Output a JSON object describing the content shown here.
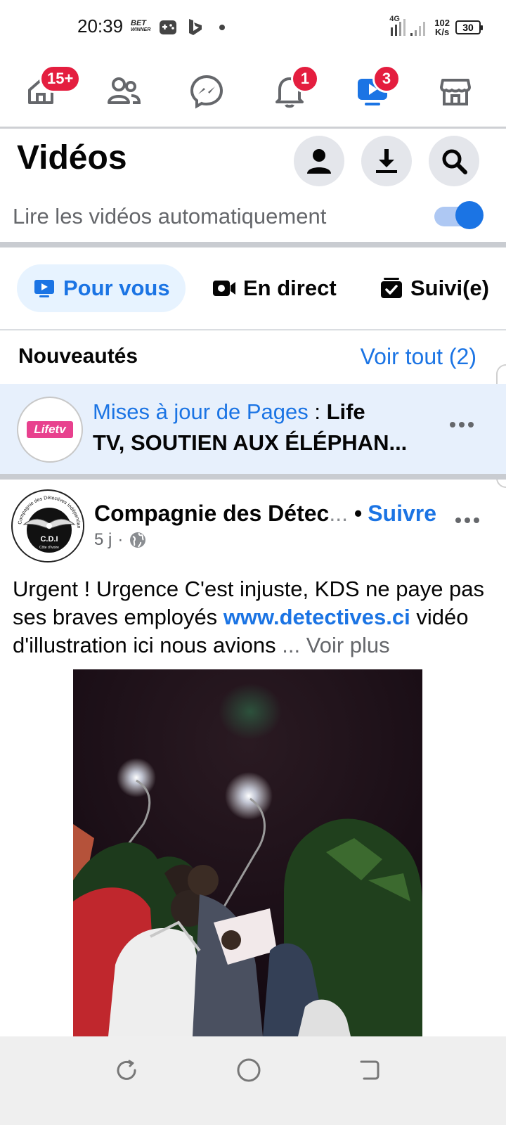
{
  "status_bar": {
    "time": "20:39",
    "bet_label_line1": "BET",
    "bet_label_line2": "WINNER",
    "network": "4G",
    "speed_value": "102",
    "speed_unit": "K/s",
    "battery": "30"
  },
  "top_nav": {
    "home_badge": "15+",
    "notifications_badge": "1",
    "videos_badge": "3",
    "active_tab": "videos",
    "accent_color": "#1b74e4",
    "badge_color": "#e41e3f"
  },
  "header": {
    "title": "Vidéos",
    "autoplay_label": "Lire les vidéos automatiquement",
    "autoplay_enabled": true
  },
  "tabs": [
    {
      "label": "Pour vous",
      "icon": "play-screen-icon",
      "selected": true
    },
    {
      "label": "En direct",
      "icon": "live-camera-icon",
      "selected": false
    },
    {
      "label": "Suivi(e)",
      "icon": "following-check-icon",
      "selected": false
    }
  ],
  "news": {
    "title": "Nouveautés",
    "see_all": "Voir tout (2)",
    "update": {
      "avatar_logo": "Lifetv",
      "prefix": "Mises à jour de Pages",
      "separator": " : ",
      "name_part1": "Life",
      "name_part2": "TV",
      "rest": ", SOUTIEN AUX ÉLÉPHAN..."
    }
  },
  "post": {
    "avatar_text": "C.D.I",
    "avatar_subtext": "Côte d'Ivoire",
    "avatar_ring_text": "Compagnie des Détectives Indépendants",
    "author": "Compagnie des Détec",
    "author_ellipsis": "...",
    "follow_bullet": "•",
    "follow": "Suivre",
    "time": "5 j",
    "meta_separator": "·",
    "text_before_link": "Urgent ! Urgence C'est injuste, KDS ne paye pas ses braves employés ",
    "link": "www.detectives.ci",
    "text_after_link": " vidéo d'illustration ici nous avions ",
    "see_more": "... Voir plus"
  }
}
